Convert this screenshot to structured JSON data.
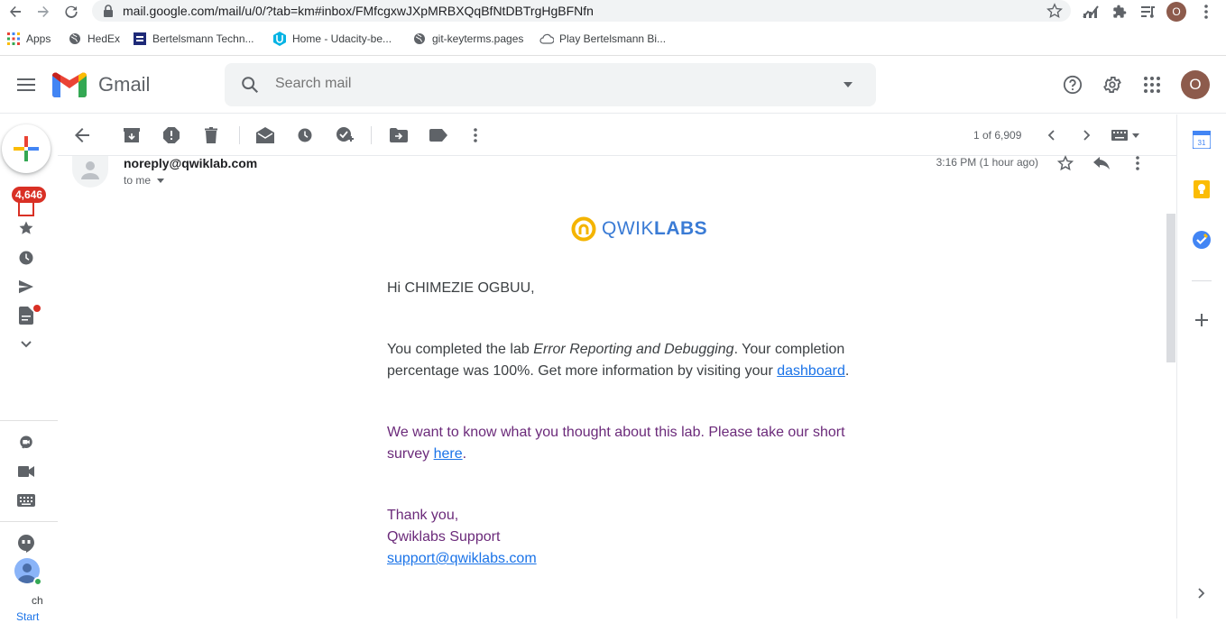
{
  "browser": {
    "url": "mail.google.com/mail/u/0/?tab=km#inbox/FMfcgxwJXpMRBXQqBfNtDBTrgHgBFNfn",
    "profile_initial": "O",
    "bookmarks": [
      {
        "label": "Apps",
        "icon": "apps-grid-icon"
      },
      {
        "label": "HedEx",
        "icon": "globe-icon"
      },
      {
        "label": "Bertelsmann Techn...",
        "icon": "bertelsmann-icon"
      },
      {
        "label": "Home - Udacity-be...",
        "icon": "udacity-icon"
      },
      {
        "label": "git-keyterms.pages",
        "icon": "globe-icon"
      },
      {
        "label": "Play Bertelsmann Bi...",
        "icon": "cloud-icon"
      }
    ]
  },
  "header": {
    "app_name": "Gmail",
    "search_placeholder": "Search mail",
    "avatar_initial": "O"
  },
  "leftrail": {
    "inbox_badge": "4,646"
  },
  "toolbar": {
    "pagination": "1 of 6,909"
  },
  "message": {
    "sender": "noreply@qwiklab.com",
    "recipient": "to me",
    "time": "3:16 PM (1 hour ago)",
    "logo_light": "QWIK",
    "logo_bold": "LABS",
    "greeting": "Hi CHIMEZIE OGBUU,",
    "p1_pre": "You completed the lab ",
    "p1_lab": "Error Reporting and Debugging",
    "p1_mid": ". Your completion percentage was 100%. Get more information by visiting your ",
    "p1_link": "dashboard",
    "p1_end": ".",
    "p2_pre": "We want to know what you thought about this lab. Please take our short survey ",
    "p2_link": "here",
    "p2_end": ".",
    "sign1": "Thank you,",
    "sign2": "Qwiklabs Support",
    "sign_email": "support@qwiklabs.com"
  },
  "hangouts": {
    "contact_short": "ch",
    "start_label": "Start"
  },
  "colors": {
    "gmail_red": "#ea4335",
    "qwiklabs_blue": "#3a7bd5",
    "qwiklabs_yellow": "#f4b400",
    "link": "#1a73e8",
    "badge": "#d93025"
  }
}
